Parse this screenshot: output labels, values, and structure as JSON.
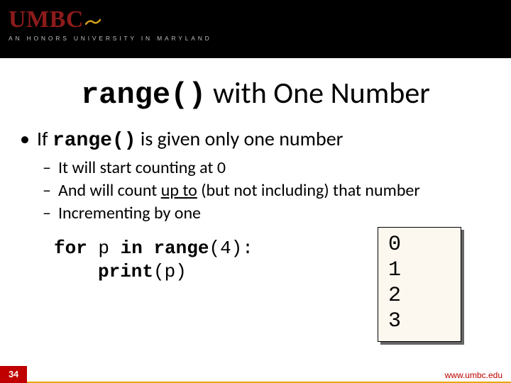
{
  "header": {
    "logo": "UMBC",
    "tagline": "AN HONORS UNIVERSITY IN MARYLAND"
  },
  "heading": {
    "mono": "range()",
    "rest": " with One Number"
  },
  "bullet1": {
    "prefix": "If ",
    "mono": "range()",
    "suffix": " is given only one number"
  },
  "sub": {
    "l1": "It will start counting at 0",
    "l2a": "And will count ",
    "l2u": "up to",
    "l2b": " (but not including) that number",
    "l3": "Incrementing by one"
  },
  "code": {
    "kw_for": "for",
    "var_p": " p ",
    "kw_in": "in",
    "sp": " ",
    "fn_range": "range",
    "call1": "(4):",
    "fn_print": "print",
    "call2": "(p)"
  },
  "output": [
    "0",
    "1",
    "2",
    "3"
  ],
  "footer": {
    "slide": "34",
    "url": "www.umbc.edu"
  }
}
